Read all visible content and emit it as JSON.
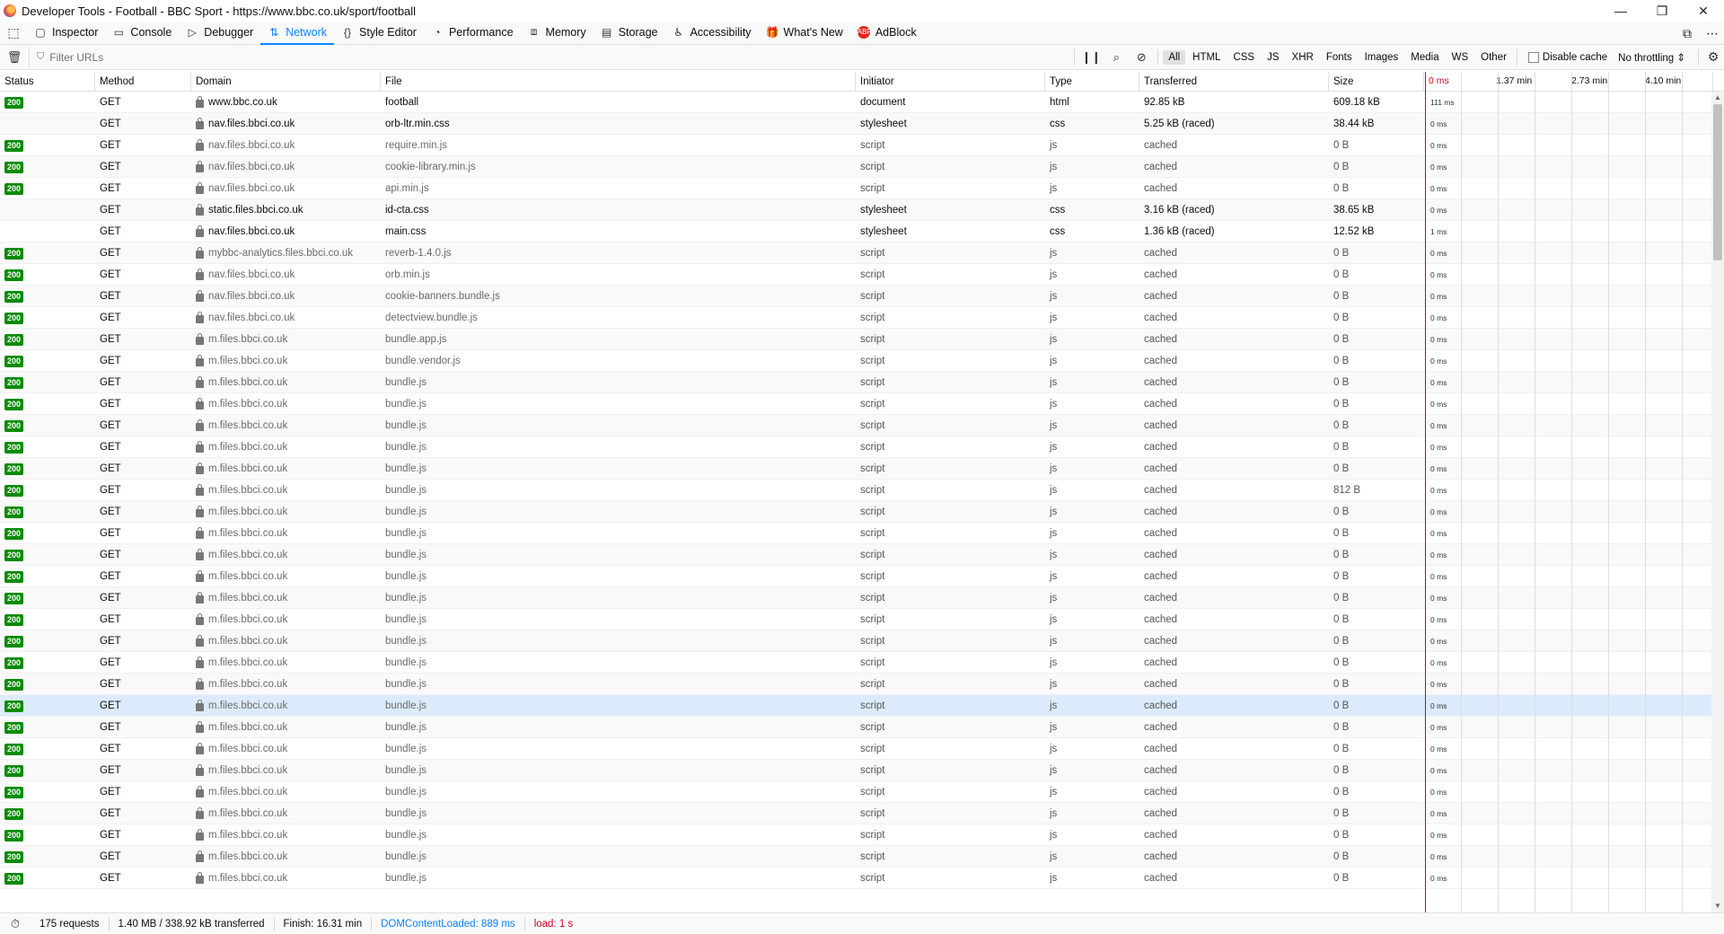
{
  "window": {
    "title": "Developer Tools - Football - BBC Sport - https://www.bbc.co.uk/sport/football",
    "controls": [
      "—",
      "❐",
      "✕"
    ]
  },
  "toolbox": {
    "tabs": [
      {
        "label": "Inspector",
        "icon": "inspector-icon",
        "glyph": "▢"
      },
      {
        "label": "Console",
        "icon": "console-icon",
        "glyph": "▭"
      },
      {
        "label": "Debugger",
        "icon": "debugger-icon",
        "glyph": "▷"
      },
      {
        "label": "Network",
        "icon": "network-icon",
        "glyph": "⇅"
      },
      {
        "label": "Style Editor",
        "icon": "style-editor-icon",
        "glyph": "{}"
      },
      {
        "label": "Performance",
        "icon": "performance-icon",
        "glyph": "◔"
      },
      {
        "label": "Memory",
        "icon": "memory-icon",
        "glyph": "⧈"
      },
      {
        "label": "Storage",
        "icon": "storage-icon",
        "glyph": "▤"
      },
      {
        "label": "Accessibility",
        "icon": "accessibility-icon",
        "glyph": "♿"
      },
      {
        "label": "What's New",
        "icon": "whats-new-icon",
        "glyph": "🎁"
      },
      {
        "label": "AdBlock",
        "icon": "adblock-icon",
        "glyph": "ABP"
      }
    ],
    "active_tab": "Network"
  },
  "filter": {
    "placeholder": "Filter URLs",
    "types": [
      "All",
      "HTML",
      "CSS",
      "JS",
      "XHR",
      "Fonts",
      "Images",
      "Media",
      "WS",
      "Other"
    ],
    "active_type": "All",
    "disable_cache_label": "Disable cache",
    "throttling": "No throttling ⇕"
  },
  "columns": {
    "status": "Status",
    "method": "Method",
    "domain": "Domain",
    "file": "File",
    "initiator": "Initiator",
    "type": "Type",
    "transferred": "Transferred",
    "size": "Size"
  },
  "waterfall": {
    "ticks": [
      "0 ms",
      "1.37 min",
      "2.73 min",
      "4.10 min"
    ]
  },
  "requests": [
    {
      "status": "200",
      "method": "GET",
      "domain": "www.bbc.co.uk",
      "file": "football",
      "initiator": "document",
      "type": "html",
      "transferred": "92.85 kB",
      "size": "609.18 kB",
      "timing": "111 ms",
      "cached": false
    },
    {
      "status": "",
      "method": "GET",
      "domain": "nav.files.bbci.co.uk",
      "file": "orb-ltr.min.css",
      "initiator": "stylesheet",
      "type": "css",
      "transferred": "5.25 kB (raced)",
      "size": "38.44 kB",
      "timing": "0 ms",
      "cached": false
    },
    {
      "status": "200",
      "method": "GET",
      "domain": "nav.files.bbci.co.uk",
      "file": "require.min.js",
      "initiator": "script",
      "type": "js",
      "transferred": "cached",
      "size": "0 B",
      "timing": "0 ms",
      "cached": true
    },
    {
      "status": "200",
      "method": "GET",
      "domain": "nav.files.bbci.co.uk",
      "file": "cookie-library.min.js",
      "initiator": "script",
      "type": "js",
      "transferred": "cached",
      "size": "0 B",
      "timing": "0 ms",
      "cached": true
    },
    {
      "status": "200",
      "method": "GET",
      "domain": "nav.files.bbci.co.uk",
      "file": "api.min.js",
      "initiator": "script",
      "type": "js",
      "transferred": "cached",
      "size": "0 B",
      "timing": "0 ms",
      "cached": true
    },
    {
      "status": "",
      "method": "GET",
      "domain": "static.files.bbci.co.uk",
      "file": "id-cta.css",
      "initiator": "stylesheet",
      "type": "css",
      "transferred": "3.16 kB (raced)",
      "size": "38.65 kB",
      "timing": "0 ms",
      "cached": false
    },
    {
      "status": "",
      "method": "GET",
      "domain": "nav.files.bbci.co.uk",
      "file": "main.css",
      "initiator": "stylesheet",
      "type": "css",
      "transferred": "1.36 kB (raced)",
      "size": "12.52 kB",
      "timing": "1 ms",
      "cached": false
    },
    {
      "status": "200",
      "method": "GET",
      "domain": "mybbc-analytics.files.bbci.co.uk",
      "file": "reverb-1.4.0.js",
      "initiator": "script",
      "type": "js",
      "transferred": "cached",
      "size": "0 B",
      "timing": "0 ms",
      "cached": true
    },
    {
      "status": "200",
      "method": "GET",
      "domain": "nav.files.bbci.co.uk",
      "file": "orb.min.js",
      "initiator": "script",
      "type": "js",
      "transferred": "cached",
      "size": "0 B",
      "timing": "0 ms",
      "cached": true
    },
    {
      "status": "200",
      "method": "GET",
      "domain": "nav.files.bbci.co.uk",
      "file": "cookie-banners.bundle.js",
      "initiator": "script",
      "type": "js",
      "transferred": "cached",
      "size": "0 B",
      "timing": "0 ms",
      "cached": true
    },
    {
      "status": "200",
      "method": "GET",
      "domain": "nav.files.bbci.co.uk",
      "file": "detectview.bundle.js",
      "initiator": "script",
      "type": "js",
      "transferred": "cached",
      "size": "0 B",
      "timing": "0 ms",
      "cached": true
    },
    {
      "status": "200",
      "method": "GET",
      "domain": "m.files.bbci.co.uk",
      "file": "bundle.app.js",
      "initiator": "script",
      "type": "js",
      "transferred": "cached",
      "size": "0 B",
      "timing": "0 ms",
      "cached": true
    },
    {
      "status": "200",
      "method": "GET",
      "domain": "m.files.bbci.co.uk",
      "file": "bundle.vendor.js",
      "initiator": "script",
      "type": "js",
      "transferred": "cached",
      "size": "0 B",
      "timing": "0 ms",
      "cached": true
    },
    {
      "status": "200",
      "method": "GET",
      "domain": "m.files.bbci.co.uk",
      "file": "bundle.js",
      "initiator": "script",
      "type": "js",
      "transferred": "cached",
      "size": "0 B",
      "timing": "0 ms",
      "cached": true
    },
    {
      "status": "200",
      "method": "GET",
      "domain": "m.files.bbci.co.uk",
      "file": "bundle.js",
      "initiator": "script",
      "type": "js",
      "transferred": "cached",
      "size": "0 B",
      "timing": "0 ms",
      "cached": true
    },
    {
      "status": "200",
      "method": "GET",
      "domain": "m.files.bbci.co.uk",
      "file": "bundle.js",
      "initiator": "script",
      "type": "js",
      "transferred": "cached",
      "size": "0 B",
      "timing": "0 ms",
      "cached": true
    },
    {
      "status": "200",
      "method": "GET",
      "domain": "m.files.bbci.co.uk",
      "file": "bundle.js",
      "initiator": "script",
      "type": "js",
      "transferred": "cached",
      "size": "0 B",
      "timing": "0 ms",
      "cached": true
    },
    {
      "status": "200",
      "method": "GET",
      "domain": "m.files.bbci.co.uk",
      "file": "bundle.js",
      "initiator": "script",
      "type": "js",
      "transferred": "cached",
      "size": "0 B",
      "timing": "0 ms",
      "cached": true
    },
    {
      "status": "200",
      "method": "GET",
      "domain": "m.files.bbci.co.uk",
      "file": "bundle.js",
      "initiator": "script",
      "type": "js",
      "transferred": "cached",
      "size": "812 B",
      "timing": "0 ms",
      "cached": true
    },
    {
      "status": "200",
      "method": "GET",
      "domain": "m.files.bbci.co.uk",
      "file": "bundle.js",
      "initiator": "script",
      "type": "js",
      "transferred": "cached",
      "size": "0 B",
      "timing": "0 ms",
      "cached": true
    },
    {
      "status": "200",
      "method": "GET",
      "domain": "m.files.bbci.co.uk",
      "file": "bundle.js",
      "initiator": "script",
      "type": "js",
      "transferred": "cached",
      "size": "0 B",
      "timing": "0 ms",
      "cached": true
    },
    {
      "status": "200",
      "method": "GET",
      "domain": "m.files.bbci.co.uk",
      "file": "bundle.js",
      "initiator": "script",
      "type": "js",
      "transferred": "cached",
      "size": "0 B",
      "timing": "0 ms",
      "cached": true
    },
    {
      "status": "200",
      "method": "GET",
      "domain": "m.files.bbci.co.uk",
      "file": "bundle.js",
      "initiator": "script",
      "type": "js",
      "transferred": "cached",
      "size": "0 B",
      "timing": "0 ms",
      "cached": true
    },
    {
      "status": "200",
      "method": "GET",
      "domain": "m.files.bbci.co.uk",
      "file": "bundle.js",
      "initiator": "script",
      "type": "js",
      "transferred": "cached",
      "size": "0 B",
      "timing": "0 ms",
      "cached": true
    },
    {
      "status": "200",
      "method": "GET",
      "domain": "m.files.bbci.co.uk",
      "file": "bundle.js",
      "initiator": "script",
      "type": "js",
      "transferred": "cached",
      "size": "0 B",
      "timing": "0 ms",
      "cached": true
    },
    {
      "status": "200",
      "method": "GET",
      "domain": "m.files.bbci.co.uk",
      "file": "bundle.js",
      "initiator": "script",
      "type": "js",
      "transferred": "cached",
      "size": "0 B",
      "timing": "0 ms",
      "cached": true
    },
    {
      "status": "200",
      "method": "GET",
      "domain": "m.files.bbci.co.uk",
      "file": "bundle.js",
      "initiator": "script",
      "type": "js",
      "transferred": "cached",
      "size": "0 B",
      "timing": "0 ms",
      "cached": true
    },
    {
      "status": "200",
      "method": "GET",
      "domain": "m.files.bbci.co.uk",
      "file": "bundle.js",
      "initiator": "script",
      "type": "js",
      "transferred": "cached",
      "size": "0 B",
      "timing": "0 ms",
      "cached": true
    },
    {
      "status": "200",
      "method": "GET",
      "domain": "m.files.bbci.co.uk",
      "file": "bundle.js",
      "initiator": "script",
      "type": "js",
      "transferred": "cached",
      "size": "0 B",
      "timing": "0 ms",
      "cached": true,
      "selected": true
    },
    {
      "status": "200",
      "method": "GET",
      "domain": "m.files.bbci.co.uk",
      "file": "bundle.js",
      "initiator": "script",
      "type": "js",
      "transferred": "cached",
      "size": "0 B",
      "timing": "0 ms",
      "cached": true
    },
    {
      "status": "200",
      "method": "GET",
      "domain": "m.files.bbci.co.uk",
      "file": "bundle.js",
      "initiator": "script",
      "type": "js",
      "transferred": "cached",
      "size": "0 B",
      "timing": "0 ms",
      "cached": true
    },
    {
      "status": "200",
      "method": "GET",
      "domain": "m.files.bbci.co.uk",
      "file": "bundle.js",
      "initiator": "script",
      "type": "js",
      "transferred": "cached",
      "size": "0 B",
      "timing": "0 ms",
      "cached": true
    },
    {
      "status": "200",
      "method": "GET",
      "domain": "m.files.bbci.co.uk",
      "file": "bundle.js",
      "initiator": "script",
      "type": "js",
      "transferred": "cached",
      "size": "0 B",
      "timing": "0 ms",
      "cached": true
    },
    {
      "status": "200",
      "method": "GET",
      "domain": "m.files.bbci.co.uk",
      "file": "bundle.js",
      "initiator": "script",
      "type": "js",
      "transferred": "cached",
      "size": "0 B",
      "timing": "0 ms",
      "cached": true
    },
    {
      "status": "200",
      "method": "GET",
      "domain": "m.files.bbci.co.uk",
      "file": "bundle.js",
      "initiator": "script",
      "type": "js",
      "transferred": "cached",
      "size": "0 B",
      "timing": "0 ms",
      "cached": true
    },
    {
      "status": "200",
      "method": "GET",
      "domain": "m.files.bbci.co.uk",
      "file": "bundle.js",
      "initiator": "script",
      "type": "js",
      "transferred": "cached",
      "size": "0 B",
      "timing": "0 ms",
      "cached": true
    },
    {
      "status": "200",
      "method": "GET",
      "domain": "m.files.bbci.co.uk",
      "file": "bundle.js",
      "initiator": "script",
      "type": "js",
      "transferred": "cached",
      "size": "0 B",
      "timing": "0 ms",
      "cached": true
    }
  ],
  "statusbar": {
    "requests": "175 requests",
    "transferred": "1.40 MB / 338.92 kB transferred",
    "finish": "Finish: 16.31 min",
    "dom_content_loaded": "DOMContentLoaded: 889 ms",
    "load": "load: 1 s"
  },
  "colors": {
    "accent": "#0a84ff",
    "status_ok": "#058b00",
    "load_marker": "#d70022"
  }
}
